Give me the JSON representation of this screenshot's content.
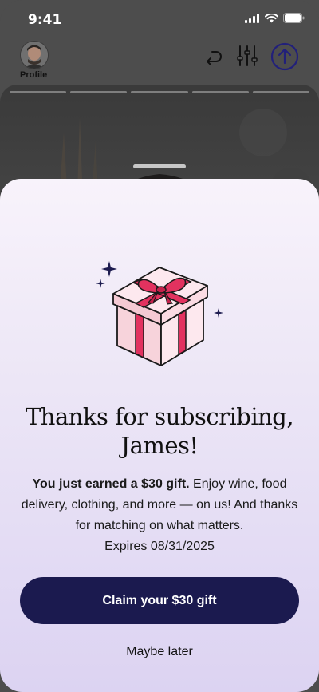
{
  "status_bar": {
    "time": "9:41"
  },
  "nav": {
    "profile_label": "Profile"
  },
  "sheet": {
    "title_line1": "Thanks for subscribing,",
    "title_line2": "James!",
    "body_bold": "You just earned a $30 gift.",
    "body_rest": " Enjoy wine, food delivery, clothing, and more — on us! And thanks for matching on what matters.",
    "expires": "Expires 08/31/2025",
    "cta_label": "Claim your $30 gift",
    "secondary_label": "Maybe later"
  },
  "colors": {
    "cta": "#1b1a4f",
    "accent_icon": "#2d2a78",
    "ribbon": "#e2325f",
    "box": "#fbe2e8"
  },
  "icons": [
    "signal-icon",
    "wifi-icon",
    "battery-icon",
    "undo-icon",
    "filter-icon",
    "upload-arrow-icon",
    "gift-icon",
    "sparkle-icon"
  ]
}
